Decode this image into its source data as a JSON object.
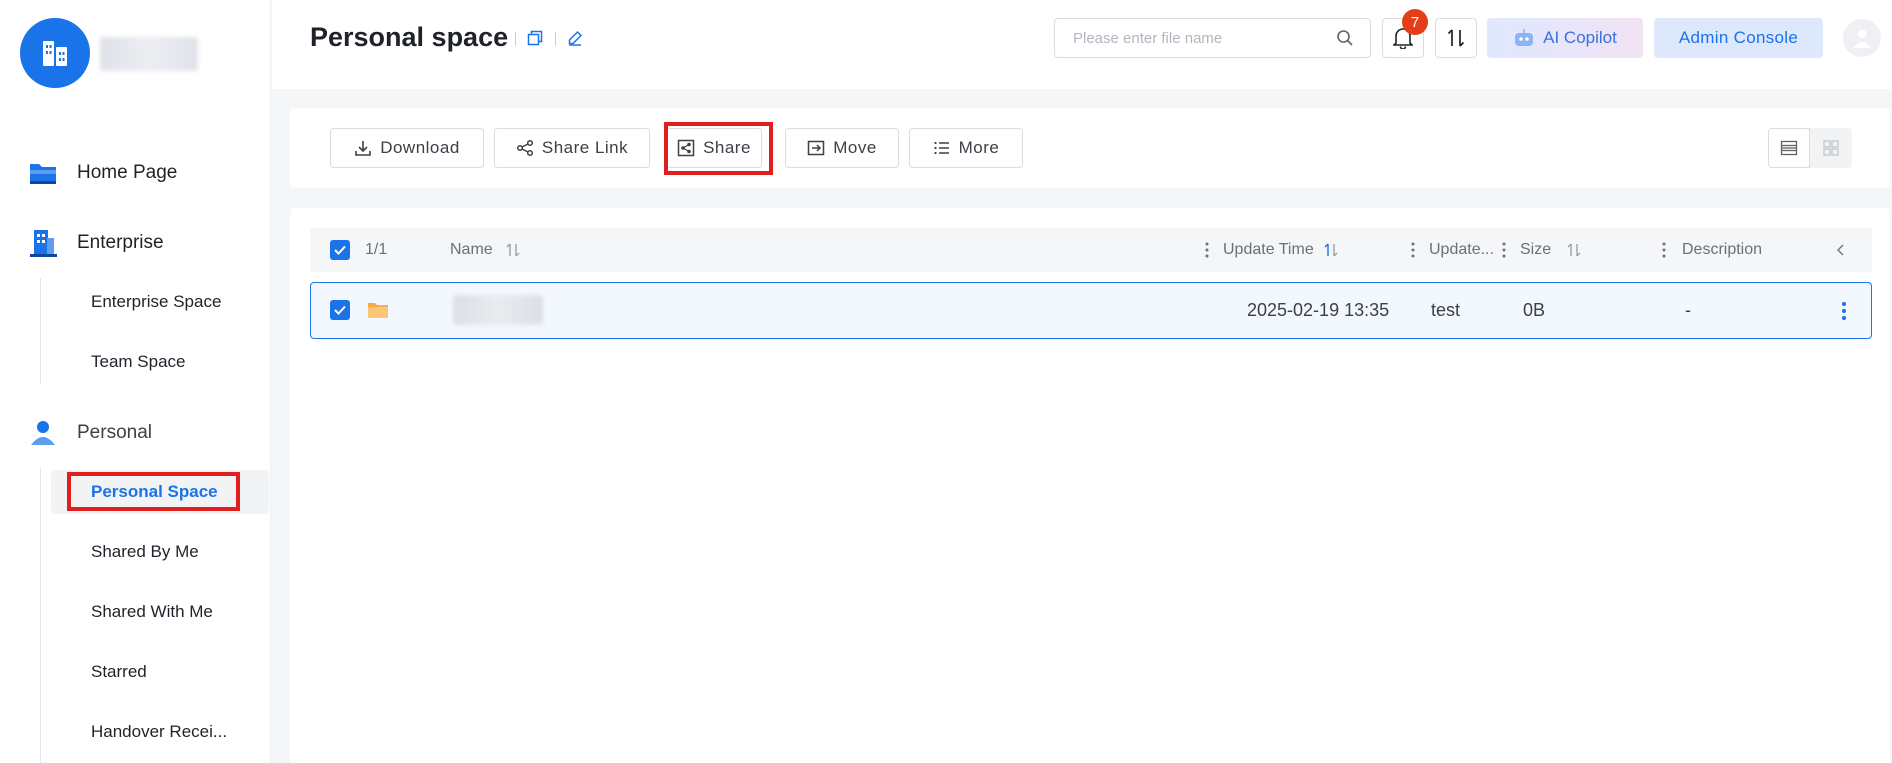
{
  "sidebar": {
    "groups": {
      "home": "Home Page",
      "enterprise": "Enterprise",
      "personal": "Personal"
    },
    "enterprise_items": [
      "Enterprise Space",
      "Team Space"
    ],
    "personal_items": [
      "Personal Space",
      "Shared By Me",
      "Shared With Me",
      "Starred",
      "Handover Recei..."
    ],
    "active_item": "Personal Space"
  },
  "header": {
    "title": "Personal space",
    "search_placeholder": "Please enter file name",
    "notification_count": "7",
    "copilot_label": "AI Copilot",
    "admin_label": "Admin Console"
  },
  "toolbar": {
    "download": "Download",
    "share_link": "Share Link",
    "share": "Share",
    "move": "Move",
    "more": "More"
  },
  "table": {
    "selection_count": "1/1",
    "columns": {
      "name": "Name",
      "update_time": "Update Time",
      "updated_by": "Update...",
      "size": "Size",
      "description": "Description"
    },
    "rows": [
      {
        "update_time": "2025-02-19 13:35",
        "updated_by": "test",
        "size": "0B",
        "description": "-"
      }
    ]
  },
  "colors": {
    "accent": "#1a73e8",
    "highlight_box": "#e02020",
    "badge": "#e53e16",
    "folder": "#f7a94b"
  }
}
